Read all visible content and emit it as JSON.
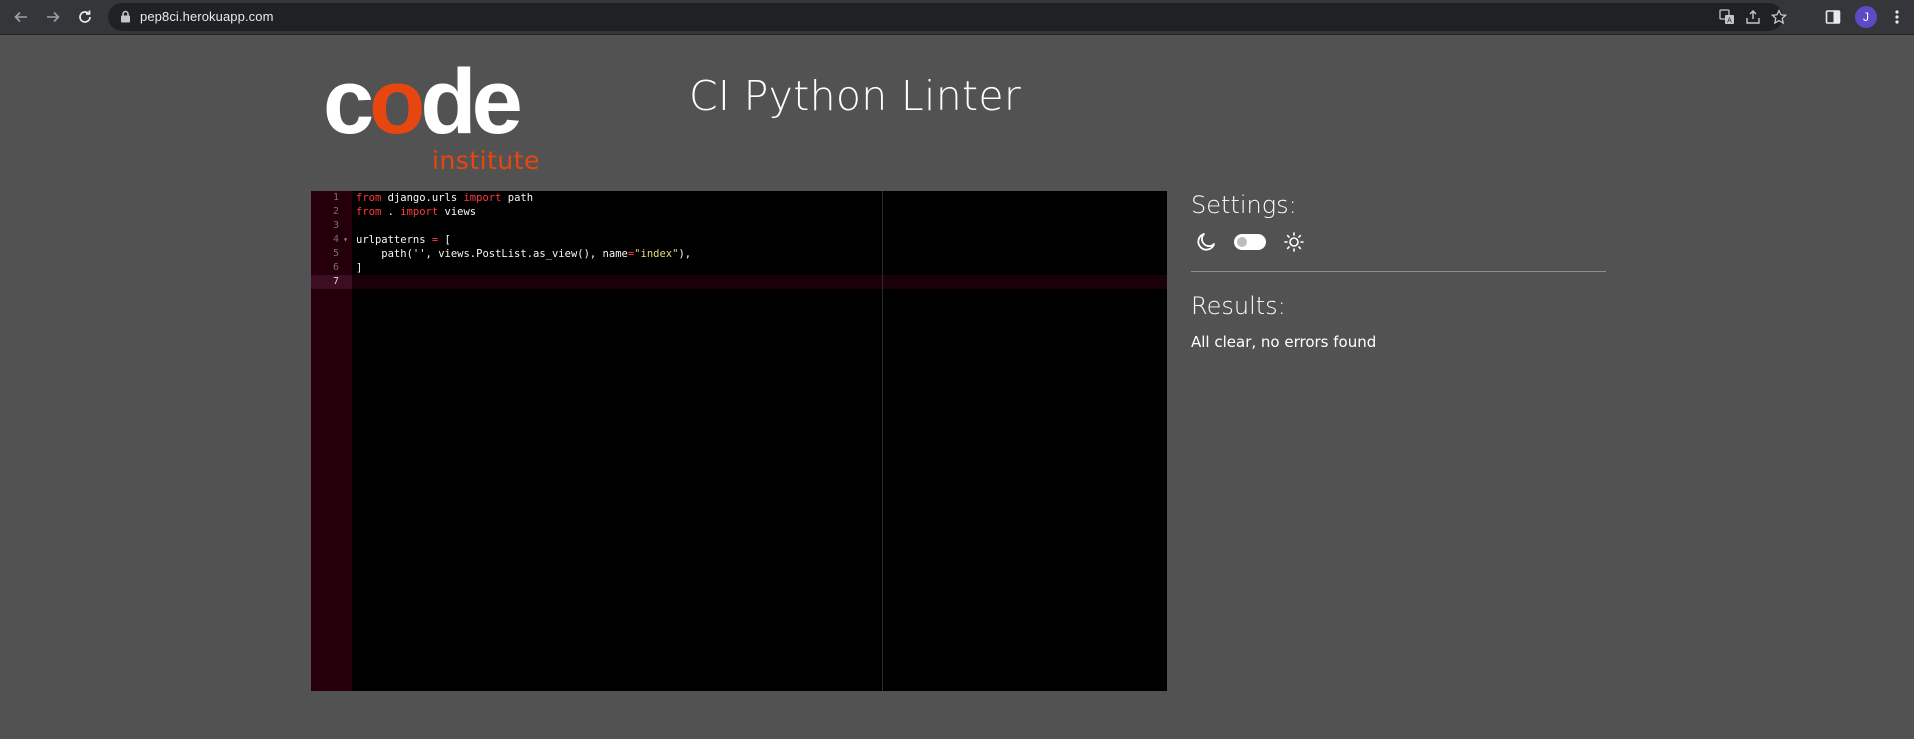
{
  "browser": {
    "url": "pep8ci.herokuapp.com",
    "profile_initial": "J"
  },
  "logo": {
    "code_c": "c",
    "code_o": "o",
    "code_de": "de",
    "subtitle": "institute",
    "brand_color": "#e84610"
  },
  "page": {
    "title": "CI Python Linter"
  },
  "editor": {
    "line_numbers": [
      "1",
      "2",
      "3",
      "4",
      "5",
      "6",
      "7"
    ],
    "lines": [
      [
        {
          "t": "from",
          "k": "kw"
        },
        {
          "t": " django.urls "
        },
        {
          "t": "import",
          "k": "kw"
        },
        {
          "t": " path"
        }
      ],
      [
        {
          "t": "from",
          "k": "kw"
        },
        {
          "t": " . "
        },
        {
          "t": "import",
          "k": "kw"
        },
        {
          "t": " views"
        }
      ],
      [],
      [
        {
          "t": "urlpatterns "
        },
        {
          "t": "=",
          "k": "kw"
        },
        {
          "t": " ["
        }
      ],
      [
        {
          "t": "    path(''"
        },
        {
          "t": ", views.PostList.as_view(), name"
        },
        {
          "t": "=",
          "k": "kw"
        },
        {
          "t": "\"index\"",
          "k": "str"
        },
        {
          "t": "),"
        }
      ],
      [
        {
          "t": "]"
        }
      ],
      []
    ],
    "active_line": 7,
    "fold_line": 4
  },
  "settings": {
    "heading": "Settings:",
    "theme_toggle": "light"
  },
  "results": {
    "heading": "Results:",
    "message": "All clear, no errors found"
  }
}
